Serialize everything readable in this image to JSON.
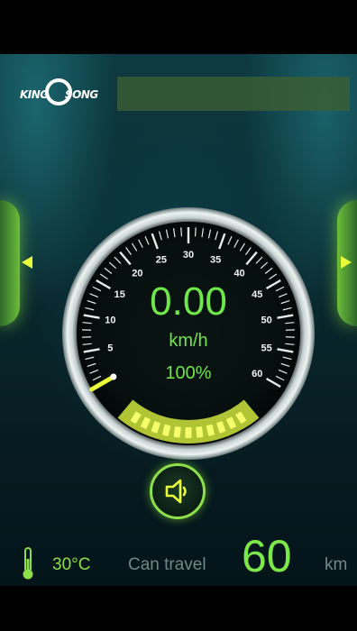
{
  "brand": {
    "logo_text_left": "KING",
    "logo_text_right": "SONG"
  },
  "header": {
    "device_name": ""
  },
  "gauge": {
    "speed": "0.00",
    "speed_unit": "km/h",
    "battery_percent": "100%",
    "tick_labels": [
      "5",
      "10",
      "15",
      "20",
      "25",
      "30",
      "35",
      "40",
      "45",
      "50",
      "55",
      "60"
    ],
    "scale_min": 0,
    "scale_max": 60,
    "battery_level": 1.0,
    "battery_segments": 11
  },
  "controls": {
    "sound_icon": "speaker-icon",
    "prev_icon": "arrow-left-icon",
    "next_icon": "arrow-right-icon"
  },
  "footer": {
    "temperature": "30°C",
    "travel_label": "Can travel",
    "range_value": "60",
    "range_unit": "km"
  },
  "colors": {
    "accent_green": "#6fe64a",
    "highlight_yellow": "#e8ff3a"
  }
}
